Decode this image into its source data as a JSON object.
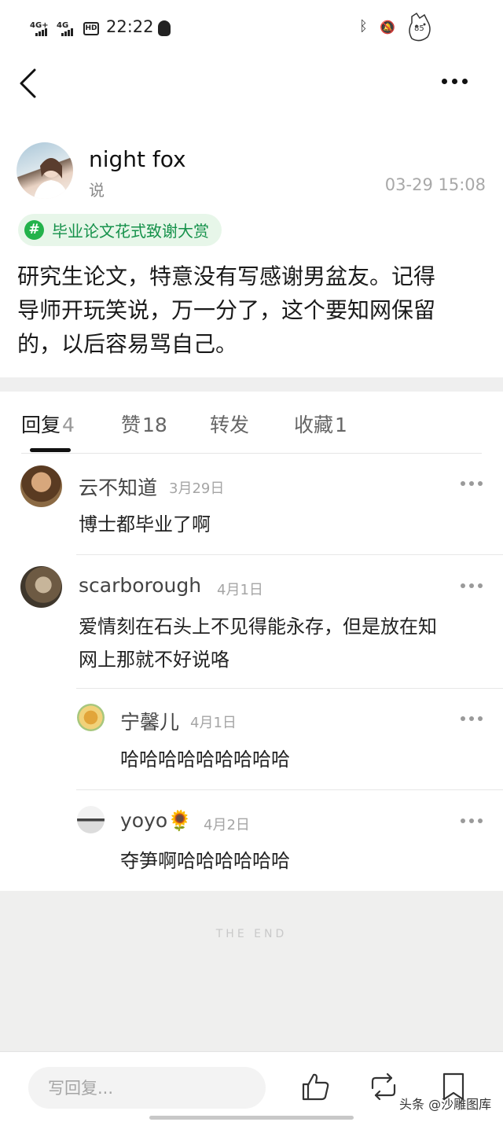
{
  "status_bar": {
    "signal_1": "4G+",
    "signal_2": "4G",
    "hd_badge": "HD",
    "time": "22:22",
    "battery_level": "85",
    "bluetooth_icon": "ᛒ",
    "mute_icon": "🔕"
  },
  "post": {
    "author": "night fox",
    "verb": "说",
    "time": "03-29 15:08",
    "topic_icon": "#",
    "topic": "毕业论文花式致谢大赏",
    "body_lines": [
      "研究生论文，特意没有写感谢男盆友。记得",
      "导师开玩笑说，万一分了，这个要知网保留",
      "的，以后容易骂自己。"
    ]
  },
  "tabs": [
    {
      "label": "回复",
      "count": "4"
    },
    {
      "label": "赞",
      "count": "18"
    },
    {
      "label": "转发",
      "count": ""
    },
    {
      "label": "收藏",
      "count": "1"
    }
  ],
  "comments": [
    {
      "name": "云不知道",
      "date": "3月29日",
      "text_lines": [
        "博士都毕业了啊"
      ]
    },
    {
      "name": "scarborough",
      "date": "4月1日",
      "text_lines": [
        "爱情刻在石头上不见得能永存，但是放在知",
        "网上那就不好说咯"
      ]
    },
    {
      "name": "宁馨儿",
      "date": "4月1日",
      "text_lines": [
        "哈哈哈哈哈哈哈哈哈"
      ]
    },
    {
      "name": "yoyo",
      "name_emoji": "🌻",
      "date": "4月2日",
      "text_lines": [
        "夺笋啊哈哈哈哈哈哈"
      ]
    }
  ],
  "end_text": "THE END",
  "bottom": {
    "reply_placeholder": "写回复...",
    "watermark": "头条 @沙雕图库"
  },
  "colors": {
    "topic_green": "#23b24b",
    "topic_bg": "#e7f6e9",
    "separator": "#efefef"
  },
  "icons": [
    "back-arrow-icon",
    "more-icon",
    "topic-hash-icon",
    "like-thumb-icon",
    "repost-icon",
    "bookmark-icon",
    "bluetooth-icon",
    "mute-icon",
    "battery-icon",
    "qq-icon"
  ]
}
